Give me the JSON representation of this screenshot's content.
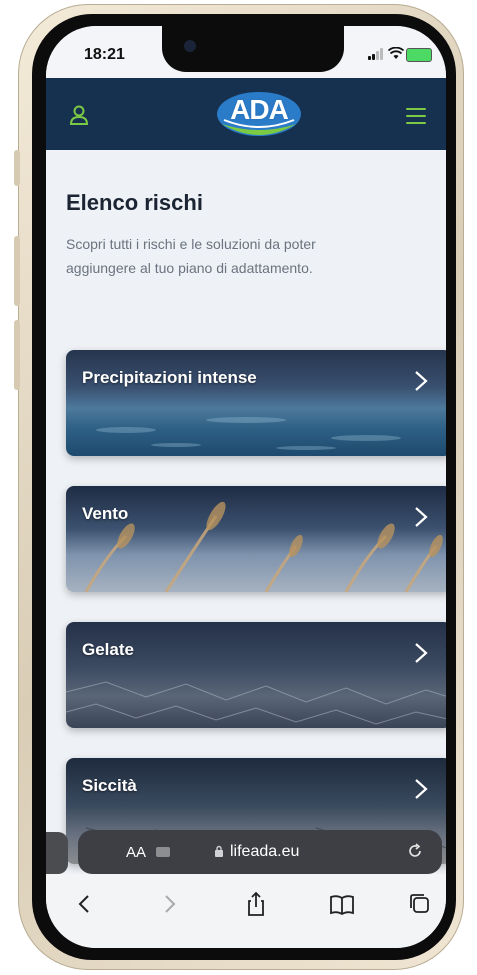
{
  "status_bar": {
    "time": "18:21"
  },
  "header": {
    "logo_text": "ADA",
    "brand_color": "#163150",
    "accent_color": "#7cc943"
  },
  "page": {
    "title": "Elenco rischi",
    "subtitle": "Scopri tutti i rischi e le soluzioni  da poter aggiungere al tuo piano di adattamento."
  },
  "risks": [
    {
      "label": "Precipitazioni intense"
    },
    {
      "label": "Vento"
    },
    {
      "label": "Gelate"
    },
    {
      "label": "Siccità"
    }
  ],
  "browser": {
    "text_size_label": "AA",
    "url": "lifeada.eu"
  },
  "icons": {
    "user": "user-icon",
    "menu": "hamburger-menu-icon",
    "chevron": "chevron-right-icon",
    "lock": "lock-icon",
    "reload": "reload-icon",
    "back": "back-icon",
    "forward": "forward-icon",
    "share": "share-icon",
    "bookmarks": "bookmarks-icon",
    "tabs": "tabs-icon"
  }
}
